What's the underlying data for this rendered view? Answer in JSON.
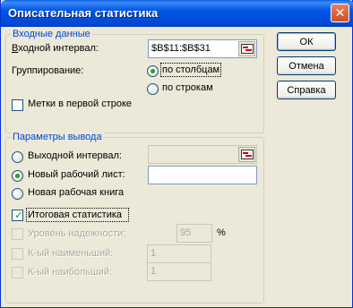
{
  "window": {
    "title": "Описательная статистика"
  },
  "input_group": {
    "title": "Входные данные",
    "input_range_label": "Входной интервал:",
    "input_range_value": "$B$11:$B$31",
    "grouping_label": "Группирование:",
    "by_columns_label": "по столбцам",
    "by_rows_label": "по строкам",
    "labels_first_row_label": "Метки в первой строке"
  },
  "output_group": {
    "title": "Параметры вывода",
    "output_range_label": "Выходной интервал:",
    "new_sheet_label": "Новый рабочий лист:",
    "new_workbook_label": "Новая рабочая книга",
    "summary_stats_label": "Итоговая статистика",
    "confidence_label": "Уровень надежности:",
    "confidence_value": "95",
    "percent_sign": "%",
    "kth_smallest_label": "К-ый наименьший:",
    "kth_smallest_value": "1",
    "kth_largest_label": "К-ый наибольший:",
    "kth_largest_value": "1"
  },
  "buttons": {
    "ok": "ОК",
    "cancel": "Отмена",
    "help": "Справка"
  },
  "icons": {
    "close": "close-icon",
    "range": "range-select-icon"
  },
  "colors": {
    "titlebar": "#0055e5",
    "group_title": "#0046d5",
    "dialog_bg": "#ece9d8"
  }
}
